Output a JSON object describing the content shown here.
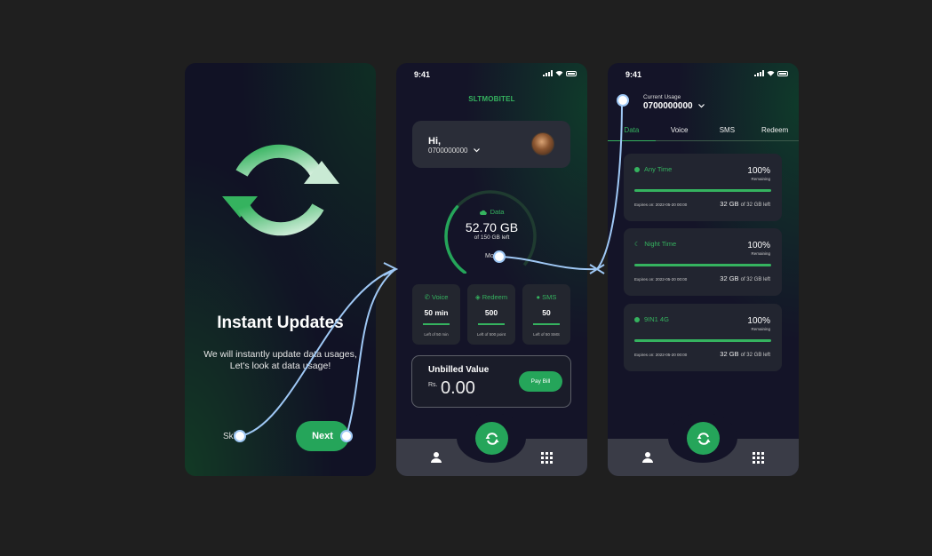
{
  "status": {
    "time": "9:41"
  },
  "onboarding": {
    "title": "Instant Updates",
    "description_line1": "We will instantly update data usages,",
    "description_line2": "Let's look at data usage!",
    "skip_label": "Skip",
    "next_label": "Next"
  },
  "home": {
    "brand": "SLTMOBITEL",
    "greeting": "Hi,",
    "number": "0700000000",
    "gauge": {
      "label": "Data",
      "value": "52.70 GB",
      "sub": "of 150 GB left",
      "more": "More",
      "fill": 0.35
    },
    "cards": [
      {
        "title": "Voice",
        "value": "50 min",
        "foot": "Left of 50 min"
      },
      {
        "title": "Redeem",
        "value": "500",
        "foot": "Left of 500 point"
      },
      {
        "title": "SMS",
        "value": "50",
        "foot": "Left of 50 SMS"
      }
    ],
    "bill": {
      "title": "Unbilled Value",
      "currency": "Rs.",
      "amount": "0.00",
      "button": "Pay Bill"
    }
  },
  "usage": {
    "label": "Current Usage",
    "number": "0700000000",
    "tabs": [
      "Data",
      "Voice",
      "SMS",
      "Redeem"
    ],
    "active_tab": "Data",
    "items": [
      {
        "name": "Any Time",
        "percent": "100%",
        "remaining": "Remaining",
        "expires": "Expires on: 2022-05-20 00:00",
        "left_value": "32 GB",
        "left_suffix": "of 32 GB left"
      },
      {
        "name": "Night Time",
        "percent": "100%",
        "remaining": "Remaining",
        "expires": "Expires on: 2022-05-20 00:00",
        "left_value": "32 GB",
        "left_suffix": "of 32 GB left"
      },
      {
        "name": "9IN1 4G",
        "percent": "100%",
        "remaining": "Remaining",
        "expires": "Expires on: 2022-05-20 00:00",
        "left_value": "32 GB",
        "left_suffix": "of 32 GB left"
      }
    ]
  },
  "colors": {
    "accent": "#25a55a",
    "background": "#1f1f1f",
    "flow": "#9fc8f5"
  },
  "icons": [
    "refresh-icon",
    "user-icon",
    "grid-icon",
    "phone-icon",
    "redeem-icon",
    "chat-icon",
    "chevron-down-icon",
    "cloud-icon"
  ]
}
